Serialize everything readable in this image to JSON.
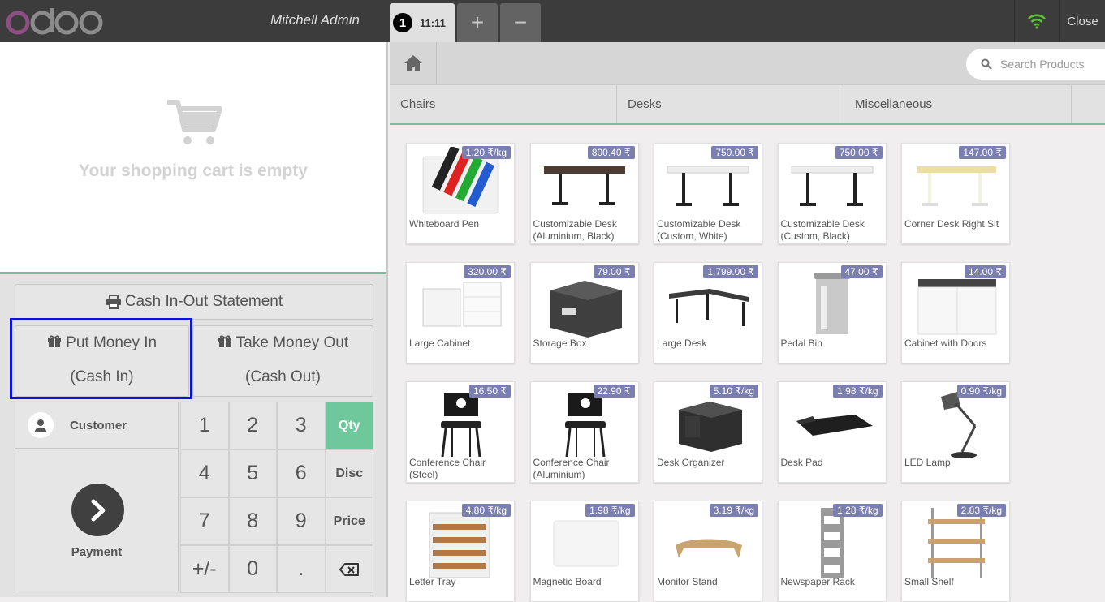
{
  "header": {
    "cashier": "Mitchell Admin",
    "order_number": "1",
    "order_time": "11:11",
    "add_label": "+",
    "remove_label": "−",
    "close_label": "Close"
  },
  "cart": {
    "empty_text": "Your shopping cart is empty"
  },
  "actions": {
    "cash_statement": "Cash In-Out Statement",
    "put_money_line1": "Put Money In",
    "put_money_line2": "(Cash In)",
    "take_money_line1": "Take Money Out",
    "take_money_line2": "(Cash Out)",
    "customer": "Customer",
    "payment": "Payment"
  },
  "numpad": {
    "keys": [
      "1",
      "2",
      "3",
      "Qty",
      "4",
      "5",
      "6",
      "Disc",
      "7",
      "8",
      "9",
      "Price",
      "+/-",
      "0",
      ".",
      "⌫"
    ],
    "active_mode": "Qty"
  },
  "search": {
    "placeholder": "Search Products"
  },
  "categories": [
    "Chairs",
    "Desks",
    "Miscellaneous"
  ],
  "products": [
    {
      "name": "Whiteboard Pen",
      "price": "1.20 ₹/kg",
      "icon": "pens"
    },
    {
      "name": "Customizable Desk (Aluminium, Black)",
      "price": "800.40 ₹",
      "icon": "desk-dark"
    },
    {
      "name": "Customizable Desk (Custom, White)",
      "price": "750.00 ₹",
      "icon": "desk-white"
    },
    {
      "name": "Customizable Desk (Custom, Black)",
      "price": "750.00 ₹",
      "icon": "desk-white"
    },
    {
      "name": "Corner Desk Right Sit",
      "price": "147.00 ₹",
      "icon": "desk-wood"
    },
    {
      "name": "Large Cabinet",
      "price": "320.00 ₹",
      "icon": "cabinet"
    },
    {
      "name": "Storage Box",
      "price": "79.00 ₹",
      "icon": "box"
    },
    {
      "name": "Large Desk",
      "price": "1,799.00 ₹",
      "icon": "large-desk"
    },
    {
      "name": "Pedal Bin",
      "price": "47.00 ₹",
      "icon": "bin"
    },
    {
      "name": "Cabinet with Doors",
      "price": "14.00 ₹",
      "icon": "cabinet-doors"
    },
    {
      "name": "Conference Chair (Steel)",
      "price": "16.50 ₹",
      "icon": "chair"
    },
    {
      "name": "Conference Chair (Aluminium)",
      "price": "22.90 ₹",
      "icon": "chair"
    },
    {
      "name": "Desk Organizer",
      "price": "5.10 ₹/kg",
      "icon": "organizer"
    },
    {
      "name": "Desk Pad",
      "price": "1.98 ₹/kg",
      "icon": "pad"
    },
    {
      "name": "LED Lamp",
      "price": "0.90 ₹/kg",
      "icon": "lamp"
    },
    {
      "name": "Letter Tray",
      "price": "4.80 ₹/kg",
      "icon": "tray"
    },
    {
      "name": "Magnetic Board",
      "price": "1.98 ₹/kg",
      "icon": "board"
    },
    {
      "name": "Monitor Stand",
      "price": "3.19 ₹/kg",
      "icon": "stand"
    },
    {
      "name": "Newspaper Rack",
      "price": "1.28 ₹/kg",
      "icon": "rack"
    },
    {
      "name": "Small Shelf",
      "price": "2.83 ₹/kg",
      "icon": "shelf"
    }
  ],
  "colors": {
    "accent": "#71c0a1",
    "price_badge": "#7b7fb0",
    "highlight": "#0a14d8"
  }
}
